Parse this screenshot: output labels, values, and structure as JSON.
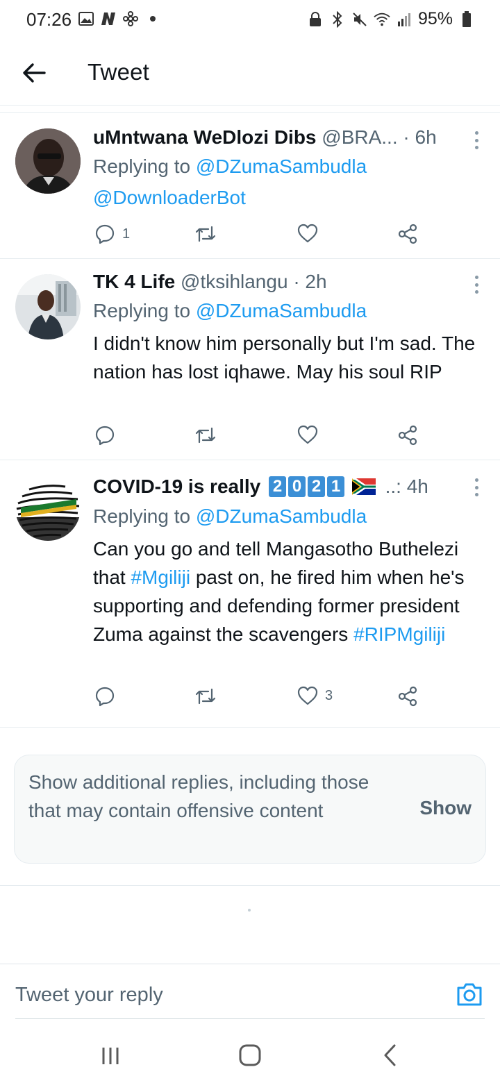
{
  "status_bar": {
    "time": "07:26",
    "battery": "95%",
    "left_icons": [
      "image-icon",
      "n-icon",
      "fan-icon",
      "dot-icon"
    ],
    "right_icons": [
      "lock-icon",
      "bluetooth-icon",
      "mute-icon",
      "wifi-icon",
      "signal-icon",
      "battery-icon"
    ]
  },
  "header": {
    "title": "Tweet"
  },
  "tweets": [
    {
      "name": "uMntwana WeDlozi Dibs",
      "handle": "@BRA...",
      "time": "· 6h",
      "replying_prefix": "Replying to ",
      "replying_to": "@DZumaSambudla",
      "extra_mention": "@DownloaderBot",
      "reply_count": "1",
      "retweet_count": "",
      "like_count": ""
    },
    {
      "name": "TK 4 Life",
      "handle": "@tksihlangu",
      "time": "· 2h",
      "replying_prefix": "Replying to ",
      "replying_to": "@DZumaSambudla",
      "body": "I didn't know him personally but I'm sad. The nation has lost iqhawe. May his soul RIP",
      "reply_count": "",
      "retweet_count": "",
      "like_count": ""
    },
    {
      "name": "COVID-19 is really",
      "badge_digits": [
        "2",
        "0",
        "2",
        "1"
      ],
      "flag": "🇿🇦",
      "handle_truncated": "..:",
      "time": "4h",
      "replying_prefix": "Replying to ",
      "replying_to": "@DZumaSambudla",
      "body_part1": "Can you go and tell Mangasotho Buthelezi that ",
      "hashtag1": "#Mgiliji",
      "body_part2": " past on, he fired him when he's supporting and defending former president Zuma against the scavengers ",
      "hashtag2": "#RIPMgiliji",
      "reply_count": "",
      "retweet_count": "",
      "like_count": "3"
    }
  ],
  "show_more": {
    "text": "Show additional replies, including those that may contain offensive content",
    "button": "Show"
  },
  "reply_bar": {
    "placeholder": "Tweet your reply"
  },
  "colors": {
    "link": "#1d9bf0",
    "muted": "#536471",
    "text": "#0f1419"
  }
}
